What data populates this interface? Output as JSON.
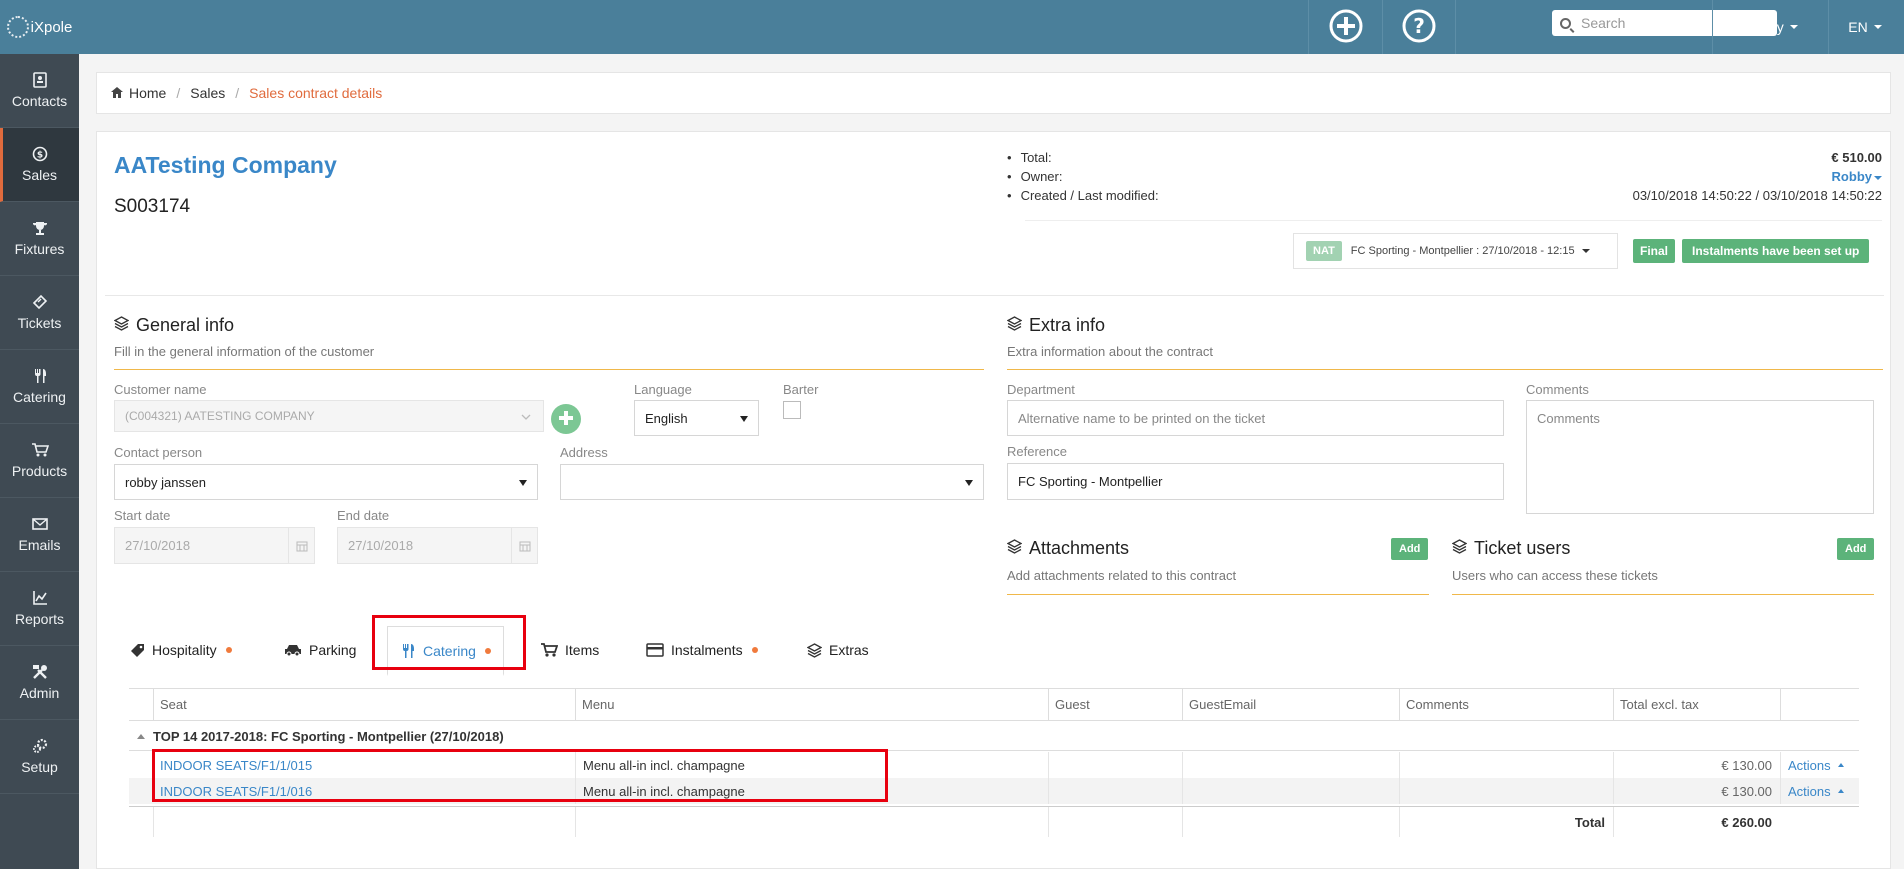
{
  "brand": "iXpole",
  "sidebar": {
    "items": [
      {
        "label": "Contacts",
        "icon": "contacts-icon"
      },
      {
        "label": "Sales",
        "icon": "dollar-icon",
        "active": true
      },
      {
        "label": "Fixtures",
        "icon": "trophy-icon"
      },
      {
        "label": "Tickets",
        "icon": "ticket-icon"
      },
      {
        "label": "Catering",
        "icon": "cutlery-icon"
      },
      {
        "label": "Products",
        "icon": "cart-icon"
      },
      {
        "label": "Emails",
        "icon": "envelope-icon"
      },
      {
        "label": "Reports",
        "icon": "chart-icon"
      },
      {
        "label": "Admin",
        "icon": "tools-icon"
      },
      {
        "label": "Setup",
        "icon": "gears-icon"
      }
    ]
  },
  "topbar": {
    "search_placeholder": "Search",
    "user": "Robby",
    "lang": "EN"
  },
  "breadcrumb": {
    "home": "Home",
    "sales": "Sales",
    "current": "Sales contract details"
  },
  "contract": {
    "company": "AATesting Company",
    "number": "S003174",
    "total_label": "Total:",
    "total_value": "€ 510.00",
    "owner_label": "Owner:",
    "owner_value": "Robby",
    "modified_label": "Created / Last modified:",
    "modified_value": "03/10/2018 14:50:22 / 03/10/2018 14:50:22",
    "nat_badge": "NAT",
    "fixture": "FC Sporting - Montpellier : 27/10/2018 - 12:15",
    "status_final": "Final",
    "status_instalments": "Instalments have been set up"
  },
  "general": {
    "title": "General info",
    "subtitle": "Fill in the general information of the customer",
    "customer_label": "Customer name",
    "customer_value": "(C004321) AATESTING COMPANY",
    "language_label": "Language",
    "language_value": "English",
    "barter_label": "Barter",
    "contact_label": "Contact person",
    "contact_value": "robby janssen",
    "address_label": "Address",
    "start_label": "Start date",
    "start_value": "27/10/2018",
    "end_label": "End date",
    "end_value": "27/10/2018"
  },
  "extra": {
    "title": "Extra info",
    "subtitle": "Extra information about the contract",
    "department_label": "Department",
    "department_placeholder": "Alternative name to be printed on the ticket",
    "comments_label": "Comments",
    "comments_placeholder": "Comments",
    "reference_label": "Reference",
    "reference_value": "FC Sporting - Montpellier"
  },
  "attachments": {
    "title": "Attachments",
    "subtitle": "Add attachments related to this contract",
    "add": "Add"
  },
  "ticket_users": {
    "title": "Ticket users",
    "subtitle": "Users who can access these tickets",
    "add": "Add"
  },
  "tabs": [
    {
      "label": "Hospitality",
      "dot": true
    },
    {
      "label": "Parking",
      "dot": false
    },
    {
      "label": "Catering",
      "dot": true,
      "active": true
    },
    {
      "label": "Items",
      "dot": false
    },
    {
      "label": "Instalments",
      "dot": true
    },
    {
      "label": "Extras",
      "dot": false
    }
  ],
  "table": {
    "headers": [
      "Seat",
      "Menu",
      "Guest",
      "GuestEmail",
      "Comments",
      "Total excl. tax"
    ],
    "group": "TOP 14 2017-2018: FC Sporting - Montpellier (27/10/2018)",
    "rows": [
      {
        "seat": "INDOOR SEATS/F1/1/015",
        "menu": "Menu all-in incl. champagne",
        "total": "€ 130.00",
        "actions": "Actions"
      },
      {
        "seat": "INDOOR SEATS/F1/1/016",
        "menu": "Menu all-in incl. champagne",
        "total": "€ 130.00",
        "actions": "Actions"
      }
    ],
    "total_label": "Total",
    "total_value": "€ 260.00"
  }
}
